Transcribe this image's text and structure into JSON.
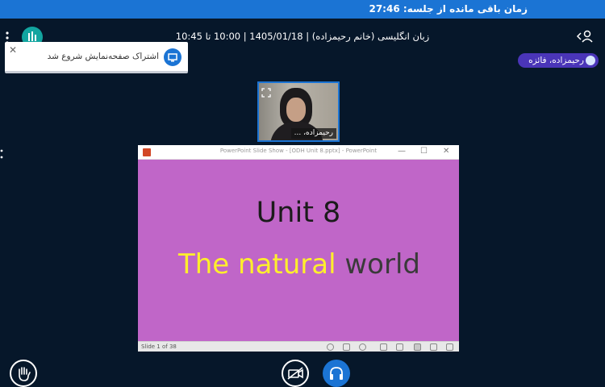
{
  "timer": {
    "label": "زمان باقی مانده از جلسه:",
    "value": "27:46"
  },
  "header": {
    "title": "زبان انگلیسی (خانم رحیمزاده) | 1405/01/18 | 10:00 تا 10:45",
    "user_icon": "user-switch-icon",
    "menu_icon": "vertical-dots-icon",
    "logo_icon": "app-logo-icon"
  },
  "notification": {
    "message": "اشتراک صفحه‌نمایش شروع شد",
    "icon": "screen-share-icon",
    "close_icon": "close-icon"
  },
  "presenter": {
    "name": "رحیمزاده، فائزه",
    "icon": "mic-icon"
  },
  "webcam": {
    "name": "رحیمزاده، ...",
    "expand_icon": "expand-icon"
  },
  "slide_window": {
    "title": "PowerPoint Slide Show - [ODH Unit 8.pptx] - PowerPoint",
    "minimize": "—",
    "maximize": "☐",
    "close": "✕",
    "slide": {
      "heading": "Unit 8",
      "subtitle_part1": "The natural",
      "subtitle_part2": "world",
      "background": "#c066c8"
    },
    "status": "Slide 1 of 38"
  },
  "controls": {
    "raise_hand": "raise-hand-icon",
    "camera": "camera-off-icon",
    "audio": "headphones-icon"
  },
  "colors": {
    "accent": "#1b74d4",
    "background": "#06172a",
    "presenter_chip": "#4a35b8"
  }
}
